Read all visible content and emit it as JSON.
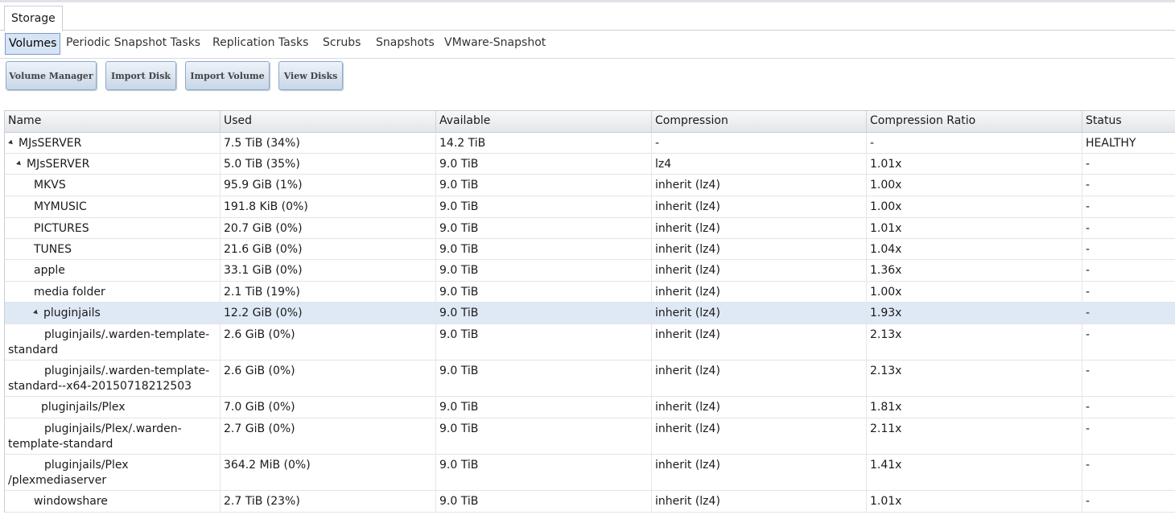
{
  "tabs": {
    "main": "Storage"
  },
  "subtabs": [
    "Volumes",
    "Periodic Snapshot Tasks",
    "Replication Tasks",
    "Scrubs",
    "Snapshots",
    "VMware-Snapshot"
  ],
  "buttons": [
    "Volume Manager",
    "Import Disk",
    "Import Volume",
    "View Disks"
  ],
  "columns": [
    "Name",
    "Used",
    "Available",
    "Compression",
    "Compression Ratio",
    "Status"
  ],
  "rows": [
    {
      "name": "MJsSERVER",
      "used": "7.5 TiB (34%)",
      "available": "14.2 TiB",
      "compression": "-",
      "ratio": "-",
      "status": "HEALTHY",
      "expanded": true
    },
    {
      "name": "MJsSERVER",
      "used": "5.0 TiB (35%)",
      "available": "9.0 TiB",
      "compression": "lz4",
      "ratio": "1.01x",
      "status": "-",
      "expanded": true
    },
    {
      "name": "MKVS",
      "used": "95.9 GiB (1%)",
      "available": "9.0 TiB",
      "compression": "inherit (lz4)",
      "ratio": "1.00x",
      "status": "-"
    },
    {
      "name": "MYMUSIC",
      "used": "191.8 KiB (0%)",
      "available": "9.0 TiB",
      "compression": "inherit (lz4)",
      "ratio": "1.00x",
      "status": "-"
    },
    {
      "name": "PICTURES",
      "used": "20.7 GiB (0%)",
      "available": "9.0 TiB",
      "compression": "inherit (lz4)",
      "ratio": "1.01x",
      "status": "-"
    },
    {
      "name": "TUNES",
      "used": "21.6 GiB (0%)",
      "available": "9.0 TiB",
      "compression": "inherit (lz4)",
      "ratio": "1.04x",
      "status": "-"
    },
    {
      "name": "apple",
      "used": "33.1 GiB (0%)",
      "available": "9.0 TiB",
      "compression": "inherit (lz4)",
      "ratio": "1.36x",
      "status": "-"
    },
    {
      "name": "media folder",
      "used": "2.1 TiB (19%)",
      "available": "9.0 TiB",
      "compression": "inherit (lz4)",
      "ratio": "1.00x",
      "status": "-"
    },
    {
      "name": "pluginjails",
      "used": "12.2 GiB (0%)",
      "available": "9.0 TiB",
      "compression": "inherit (lz4)",
      "ratio": "1.93x",
      "status": "-",
      "expanded": true,
      "selected": true
    },
    {
      "name": "pluginjails/.warden-template-\nstandard",
      "used": "2.6 GiB (0%)",
      "available": "9.0 TiB",
      "compression": "inherit (lz4)",
      "ratio": "2.13x",
      "status": "-"
    },
    {
      "name": "pluginjails/.warden-template-\nstandard--x64-20150718212503",
      "used": "2.6 GiB (0%)",
      "available": "9.0 TiB",
      "compression": "inherit (lz4)",
      "ratio": "2.13x",
      "status": "-"
    },
    {
      "name": "pluginjails/Plex",
      "used": "7.0 GiB (0%)",
      "available": "9.0 TiB",
      "compression": "inherit (lz4)",
      "ratio": "1.81x",
      "status": "-"
    },
    {
      "name": "pluginjails/Plex/.warden-\ntemplate-standard",
      "used": "2.7 GiB (0%)",
      "available": "9.0 TiB",
      "compression": "inherit (lz4)",
      "ratio": "2.11x",
      "status": "-"
    },
    {
      "name": "pluginjails/Plex\n/plexmediaserver",
      "used": "364.2 MiB (0%)",
      "available": "9.0 TiB",
      "compression": "inherit (lz4)",
      "ratio": "1.41x",
      "status": "-"
    },
    {
      "name": "windowshare",
      "used": "2.7 TiB (23%)",
      "available": "9.0 TiB",
      "compression": "inherit (lz4)",
      "ratio": "1.01x",
      "status": "-"
    }
  ]
}
